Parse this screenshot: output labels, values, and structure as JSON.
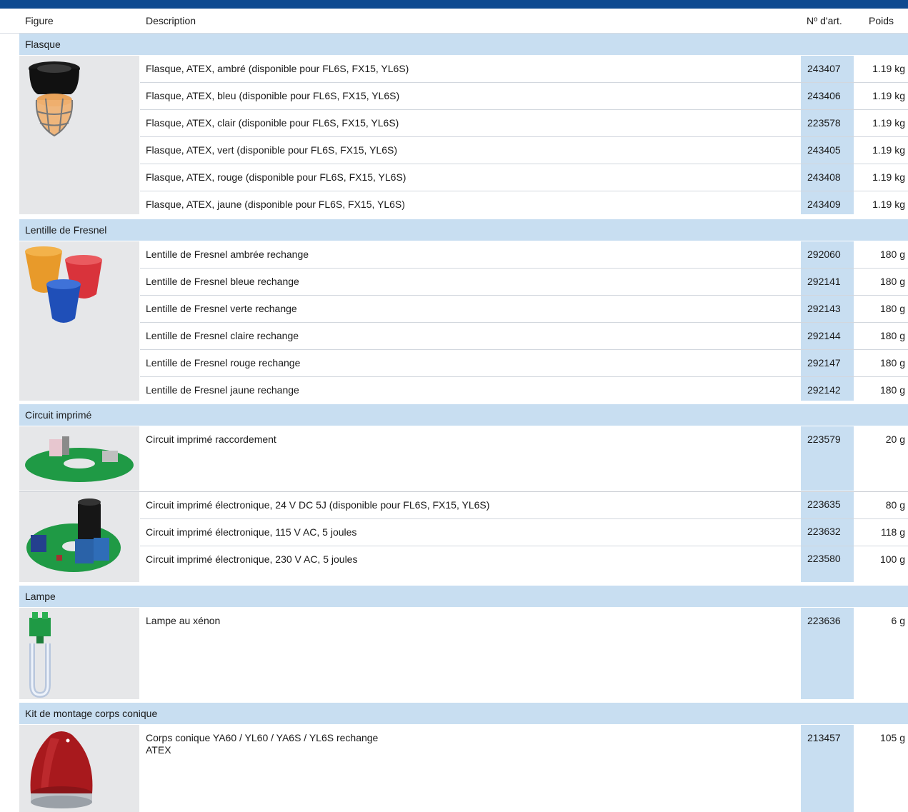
{
  "header": {
    "figure": "Figure",
    "description": "Description",
    "art_no": "Nº d'art.",
    "weight": "Poids"
  },
  "categories": [
    {
      "title": "Flasque",
      "icon": "flasque-dome-icon",
      "items": [
        {
          "description": "Flasque, ATEX, ambré (disponible pour FL6S, FX15, YL6S)",
          "art_no": "243407",
          "weight": "1.19 kg"
        },
        {
          "description": "Flasque, ATEX, bleu (disponible pour FL6S, FX15, YL6S)",
          "art_no": "243406",
          "weight": "1.19 kg"
        },
        {
          "description": "Flasque, ATEX, clair (disponible pour FL6S, FX15, YL6S)",
          "art_no": "223578",
          "weight": "1.19 kg"
        },
        {
          "description": "Flasque, ATEX, vert (disponible pour FL6S, FX15, YL6S)",
          "art_no": "243405",
          "weight": "1.19 kg"
        },
        {
          "description": "Flasque, ATEX, rouge (disponible pour FL6S, FX15, YL6S)",
          "art_no": "243408",
          "weight": "1.19 kg"
        },
        {
          "description": "Flasque, ATEX, jaune (disponible pour FL6S, FX15, YL6S)",
          "art_no": "243409",
          "weight": "1.19 kg"
        }
      ]
    },
    {
      "title": "Lentille de Fresnel",
      "icon": "fresnel-lens-icon",
      "items": [
        {
          "description": "Lentille de Fresnel ambrée rechange",
          "art_no": "292060",
          "weight": "180 g"
        },
        {
          "description": "Lentille de Fresnel bleue rechange",
          "art_no": "292141",
          "weight": "180 g"
        },
        {
          "description": "Lentille de Fresnel verte rechange",
          "art_no": "292143",
          "weight": "180 g"
        },
        {
          "description": "Lentille de Fresnel claire rechange",
          "art_no": "292144",
          "weight": "180 g"
        },
        {
          "description": "Lentille de Fresnel rouge rechange",
          "art_no": "292147",
          "weight": "180 g"
        },
        {
          "description": "Lentille de Fresnel jaune rechange",
          "art_no": "292142",
          "weight": "180 g"
        }
      ]
    },
    {
      "title": "Circuit imprimé",
      "groups": [
        {
          "icon": "pcb-connection-icon",
          "items": [
            {
              "description": "Circuit imprimé raccordement",
              "art_no": "223579",
              "weight": "20 g"
            }
          ]
        },
        {
          "icon": "pcb-electronic-icon",
          "items": [
            {
              "description": "Circuit imprimé électronique, 24 V DC 5J (disponible pour FL6S, FX15, YL6S)",
              "art_no": "223635",
              "weight": "80 g"
            },
            {
              "description": "Circuit imprimé électronique, 115 V AC, 5 joules",
              "art_no": "223632",
              "weight": "118 g"
            },
            {
              "description": "Circuit imprimé électronique, 230 V AC, 5 joules",
              "art_no": "223580",
              "weight": "100 g"
            }
          ]
        }
      ]
    },
    {
      "title": "Lampe",
      "icon": "xenon-lamp-icon",
      "items": [
        {
          "description": "Lampe au xénon",
          "art_no": "223636",
          "weight": "6 g"
        }
      ]
    },
    {
      "title": "Kit de montage corps conique",
      "icon": "conical-body-icon",
      "items": [
        {
          "description": "Corps conique YA60 / YL60 / YA6S / YL6S rechange\nATEX",
          "art_no": "213457",
          "weight": "105 g"
        }
      ]
    }
  ],
  "colors": {
    "top_bar": "#0d4990",
    "category_bg": "#c8def1",
    "figure_bg": "#e6e7e9"
  }
}
